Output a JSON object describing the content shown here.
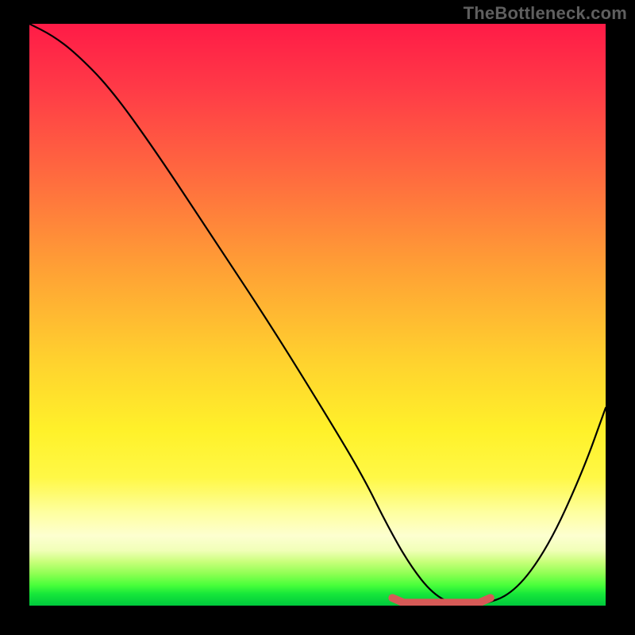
{
  "watermark": "TheBottleneck.com",
  "chart_data": {
    "type": "line",
    "title": "",
    "xlabel": "",
    "ylabel": "",
    "xlim": [
      0,
      100
    ],
    "ylim": [
      0,
      100
    ],
    "series": [
      {
        "name": "curve",
        "x": [
          0,
          4,
          8,
          14,
          22,
          32,
          42,
          52,
          58,
          62,
          66,
          70,
          74,
          78,
          84,
          90,
          96,
          100
        ],
        "y": [
          100,
          98,
          95,
          89,
          78,
          63,
          48,
          32,
          22,
          14,
          7,
          2,
          0,
          0,
          2,
          10,
          23,
          34
        ]
      }
    ],
    "minimum_band": {
      "name": "optimal-range",
      "x": [
        63,
        80
      ],
      "y": [
        0.5,
        0.5
      ]
    },
    "background_gradient": {
      "stops": [
        {
          "pos": 0,
          "color": "#ff1b47"
        },
        {
          "pos": 50,
          "color": "#ffc030"
        },
        {
          "pos": 75,
          "color": "#fff030"
        },
        {
          "pos": 92,
          "color": "#d0ff80"
        },
        {
          "pos": 100,
          "color": "#00c93c"
        }
      ]
    }
  }
}
